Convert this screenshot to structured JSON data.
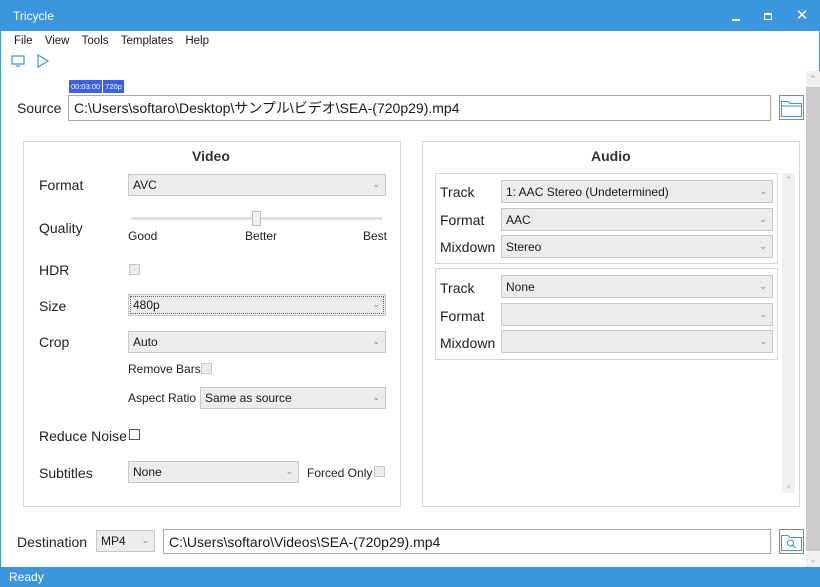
{
  "window": {
    "title": "Tricycle",
    "controls": {
      "minimize": "minimize",
      "maximize": "maximize",
      "close": "✕"
    }
  },
  "menu": {
    "items": [
      "File",
      "View",
      "Tools",
      "Templates",
      "Help"
    ]
  },
  "toolbar": {
    "icons": [
      "monitor-icon",
      "play-icon"
    ]
  },
  "source_info": {
    "duration": "00:03:00",
    "resolution": "720p"
  },
  "source": {
    "label": "Source",
    "path": "C:\\Users\\softaro\\Desktop\\サンプル\\ビデオ\\SEA-(720p29).mp4"
  },
  "video": {
    "title": "Video",
    "format": {
      "label": "Format",
      "value": "AVC"
    },
    "quality": {
      "label": "Quality",
      "ticks": [
        "Good",
        "Better",
        "Best"
      ],
      "value_fraction": 0.5
    },
    "hdr": {
      "label": "HDR",
      "checked": false,
      "enabled": false
    },
    "size": {
      "label": "Size",
      "value": "480p"
    },
    "crop": {
      "label": "Crop",
      "value": "Auto"
    },
    "remove_bars": {
      "label": "Remove Bars",
      "checked": false
    },
    "aspect_ratio": {
      "label": "Aspect Ratio",
      "value": "Same as source"
    },
    "reduce_noise": {
      "label": "Reduce Noise",
      "checked": false
    },
    "subtitles": {
      "label": "Subtitles",
      "value": "None"
    },
    "forced_only": {
      "label": "Forced Only",
      "checked": false
    }
  },
  "audio": {
    "title": "Audio",
    "tracks": [
      {
        "track_label": "Track",
        "track_value": "1: AAC Stereo (Undetermined)",
        "format_label": "Format",
        "format_value": "AAC",
        "mixdown_label": "Mixdown",
        "mixdown_value": "Stereo"
      },
      {
        "track_label": "Track",
        "track_value": "None",
        "format_label": "Format",
        "format_value": "",
        "mixdown_label": "Mixdown",
        "mixdown_value": ""
      }
    ]
  },
  "destination": {
    "label": "Destination",
    "container": "MP4",
    "path": "C:\\Users\\softaro\\Videos\\SEA-(720p29).mp4"
  },
  "status": {
    "text": "Ready"
  },
  "colors": {
    "accent": "#3a96dd",
    "badge": "#3a5ff5"
  }
}
